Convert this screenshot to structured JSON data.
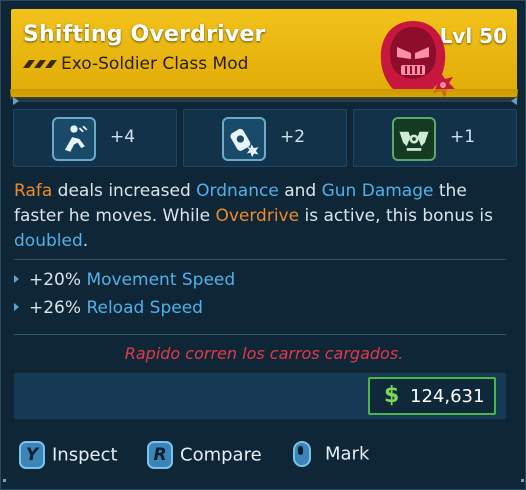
{
  "item": {
    "title": "Shifting Overdriver",
    "subtitle": "Exo-Soldier Class Mod",
    "level": "Lvl 50",
    "rarity_color": "#f2c21a",
    "class_icon": "hooded-skull-icon"
  },
  "skills": [
    {
      "icon": "soldier-slide-icon",
      "value": "+4"
    },
    {
      "icon": "grenade-blast-icon",
      "value": "+2"
    },
    {
      "icon": "winged-emblem-icon",
      "value": "+1"
    }
  ],
  "description": {
    "p1": "Rafa",
    "p2": " deals increased ",
    "p3": "Ordnance",
    "p4": " and ",
    "p5": "Gun Damage",
    "p6": " the faster he moves. While ",
    "p7": "Overdrive",
    "p8": " is active, this bonus is ",
    "p9": "doubled",
    "p10": "."
  },
  "stats": [
    {
      "value": "+20%",
      "label": "Movement Speed"
    },
    {
      "value": "+26%",
      "label": "Reload Speed"
    }
  ],
  "flavor": "Rapido corren los carros cargados.",
  "price": {
    "symbol": "$",
    "amount": "124,631"
  },
  "actions": [
    {
      "key": "Y",
      "label": "Inspect"
    },
    {
      "key": "R",
      "label": "Compare"
    },
    {
      "key": "mouse",
      "label": "Mark"
    }
  ],
  "colors": {
    "orange": "#ee8a2a",
    "blue": "#4fb2ea",
    "flavor_red": "#e0394a",
    "money_green": "#4bb64a"
  }
}
